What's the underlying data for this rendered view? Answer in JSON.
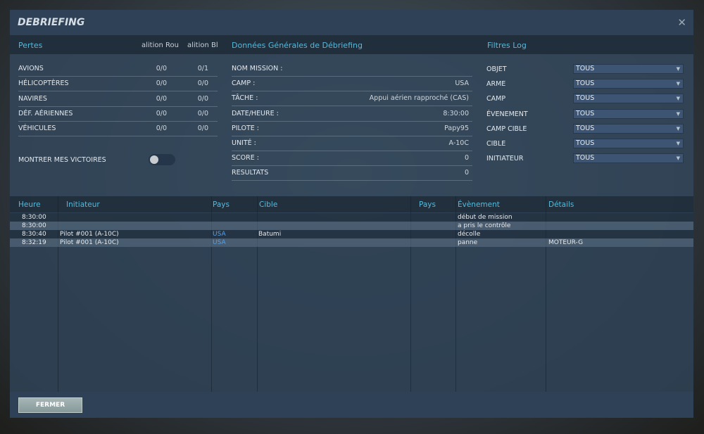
{
  "title": "DEBRIEFING",
  "losses": {
    "header": "Pertes",
    "col_red": "alition Rou",
    "col_blue": "alition Bl",
    "rows": [
      {
        "label": "AVIONS",
        "red": "0/0",
        "blue": "0/1"
      },
      {
        "label": "HÉLICOPTÈRES",
        "red": "0/0",
        "blue": "0/0"
      },
      {
        "label": "NAVIRES",
        "red": "0/0",
        "blue": "0/0"
      },
      {
        "label": "DÉF. AÉRIENNES",
        "red": "0/0",
        "blue": "0/0"
      },
      {
        "label": "VÉHICULES",
        "red": "0/0",
        "blue": "0/0"
      }
    ],
    "toggle_label": "MONTRER MES VICTOIRES",
    "toggle_on": false
  },
  "general": {
    "header": "Données Générales de Débriefing",
    "rows": [
      {
        "label": "NOM MISSION :",
        "value": ""
      },
      {
        "label": "CAMP :",
        "value": "USA"
      },
      {
        "label": "TÂCHE :",
        "value": "Appui aérien rapproché (CAS)"
      },
      {
        "label": "DATE/HEURE :",
        "value": "8:30:00"
      },
      {
        "label": "PILOTE :",
        "value": "Papy95"
      },
      {
        "label": "UNITÉ :",
        "value": "A-10C"
      },
      {
        "label": "SCORE :",
        "value": "0"
      },
      {
        "label": "RESULTATS",
        "value": "0"
      }
    ]
  },
  "filters": {
    "header": "Filtres Log",
    "rows": [
      {
        "label": "OBJET",
        "value": "TOUS"
      },
      {
        "label": "ARME",
        "value": "TOUS"
      },
      {
        "label": "CAMP",
        "value": "TOUS"
      },
      {
        "label": "ÉVENEMENT",
        "value": "TOUS"
      },
      {
        "label": "CAMP CIBLE",
        "value": "TOUS"
      },
      {
        "label": "CIBLE",
        "value": "TOUS"
      },
      {
        "label": "INITIATEUR",
        "value": "TOUS"
      }
    ]
  },
  "log": {
    "columns": [
      "Heure",
      "Initiateur",
      "Pays",
      "Cible",
      "Pays",
      "Évènement",
      "Détails"
    ],
    "rows": [
      [
        "8:30:00",
        "",
        "",
        "",
        "",
        "début de mission",
        ""
      ],
      [
        "8:30:00",
        "",
        "",
        "",
        "",
        "a pris le contrôle",
        ""
      ],
      [
        "8:30:40",
        "Pilot #001 (A-10C)",
        "USA",
        "Batumi",
        "",
        "décolle",
        ""
      ],
      [
        "8:32:19",
        "Pilot #001 (A-10C)",
        "USA",
        "",
        "",
        "panne",
        "MOTEUR-G"
      ]
    ]
  },
  "footer": {
    "close_label": "FERMER"
  }
}
